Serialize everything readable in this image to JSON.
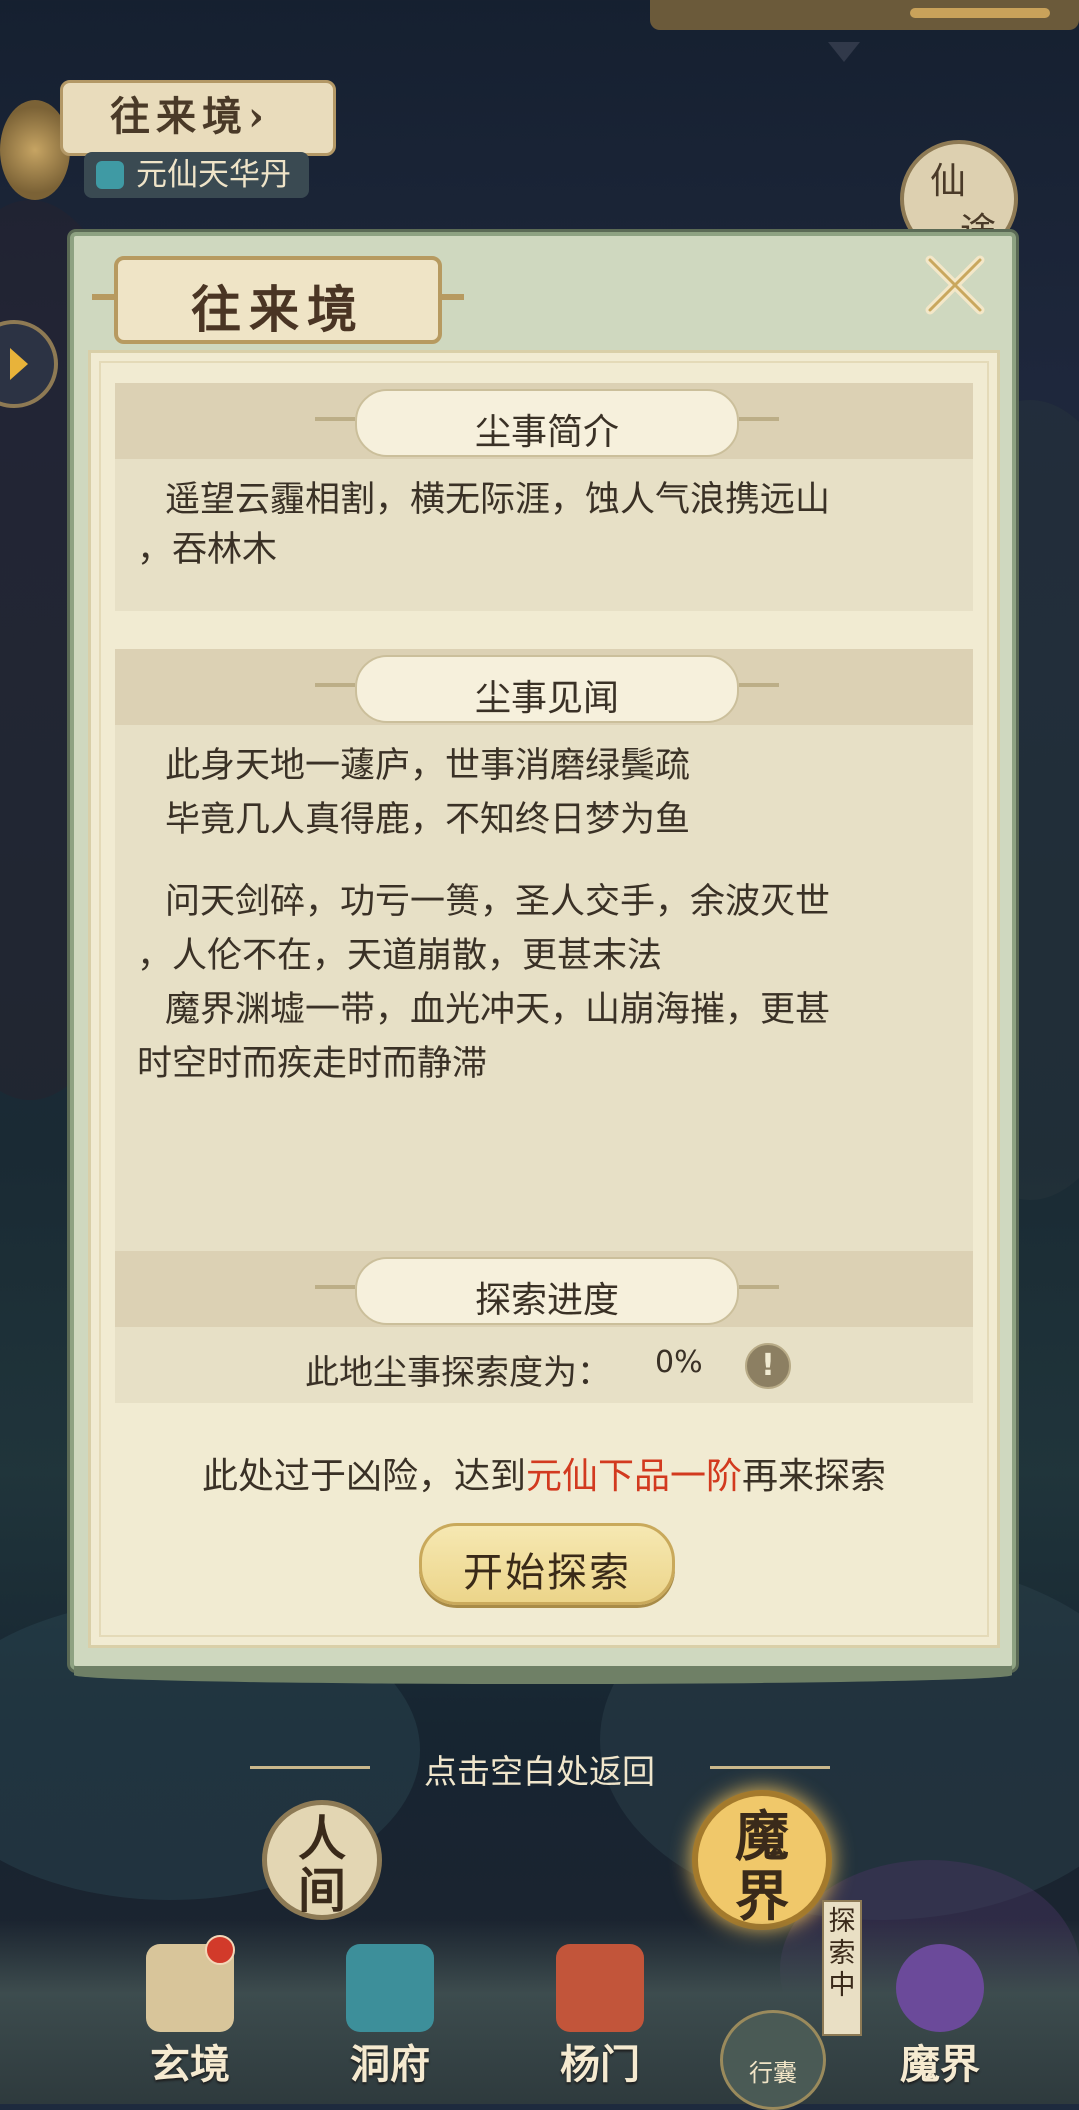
{
  "area": {
    "name": "往来境",
    "name_arrow": "›",
    "item_name": "元仙天华丹"
  },
  "corner_badge": "仙途",
  "dialog": {
    "title": "往来境",
    "sections": {
      "intro": {
        "label": "尘事简介",
        "lines": [
          "遥望云霾相割，横无际涯，蚀人气浪携远山",
          "，吞林木"
        ]
      },
      "lore": {
        "label": "尘事见闻",
        "lines": [
          "此身天地一蘧庐，世事消磨绿鬓疏",
          "毕竟几人真得鹿，不知终日梦为鱼",
          "问天剑碎，功亏一篑，圣人交手，余波灭世",
          "，人伦不在，天道崩散，更甚末法",
          "魔界渊墟一带，血光冲天，山崩海摧，更甚",
          "时空时而疾走时而静滞"
        ]
      },
      "progress": {
        "label": "探索进度",
        "text": "此地尘事探索度为：",
        "value": "0%",
        "fraction": 0
      }
    },
    "warning": {
      "prefix": "此处过于凶险，达到",
      "highlight": "元仙下品一阶",
      "suffix": "再来探索"
    },
    "start_button": "开始探索"
  },
  "return_hint": "点击空白处返回",
  "realms": {
    "renjian": [
      "人",
      "间"
    ],
    "mojie": [
      "魔",
      "界"
    ]
  },
  "explore_tag": [
    "探",
    "索",
    "中"
  ],
  "nav": {
    "xuanjing": "玄境",
    "dongfu": "洞府",
    "yangmen": "杨门",
    "xingnang": "行囊",
    "mojie": "魔界"
  },
  "colors": {
    "highlight_red": "#d23a1f",
    "paper": "#f1ebd2",
    "frame_green": "#cfd8bf",
    "button_gold": "#ecd58a"
  }
}
